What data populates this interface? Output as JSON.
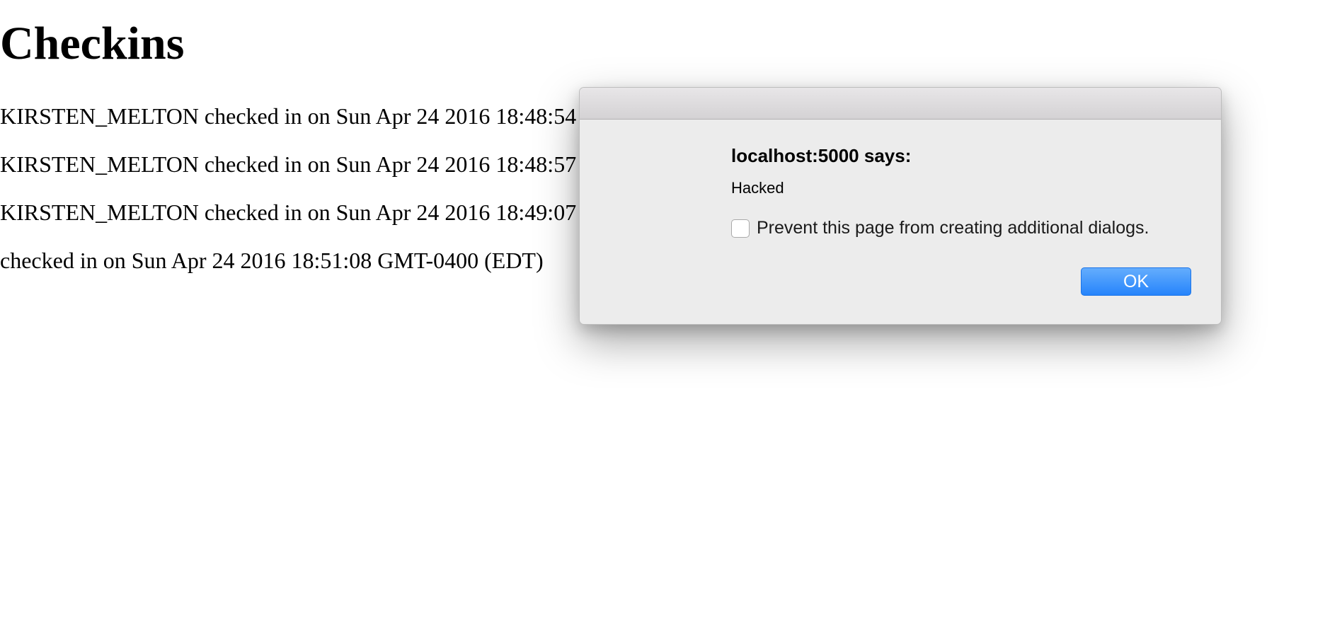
{
  "page": {
    "title": "Checkins",
    "checkins": [
      "KIRSTEN_MELTON checked in on Sun Apr 24 2016 18:48:54 GMT-0400 (EDT)",
      "KIRSTEN_MELTON checked in on Sun Apr 24 2016 18:48:57 GMT-0400 (EDT)",
      "KIRSTEN_MELTON checked in on Sun Apr 24 2016 18:49:07 GMT-0400 (EDT)",
      "checked in on Sun Apr 24 2016 18:51:08 GMT-0400 (EDT)"
    ]
  },
  "dialog": {
    "origin": "localhost:5000 says:",
    "message": "Hacked",
    "prevent_label": "Prevent this page from creating additional dialogs.",
    "prevent_checked": false,
    "ok_label": "OK",
    "ok_color": "#2684fb"
  }
}
